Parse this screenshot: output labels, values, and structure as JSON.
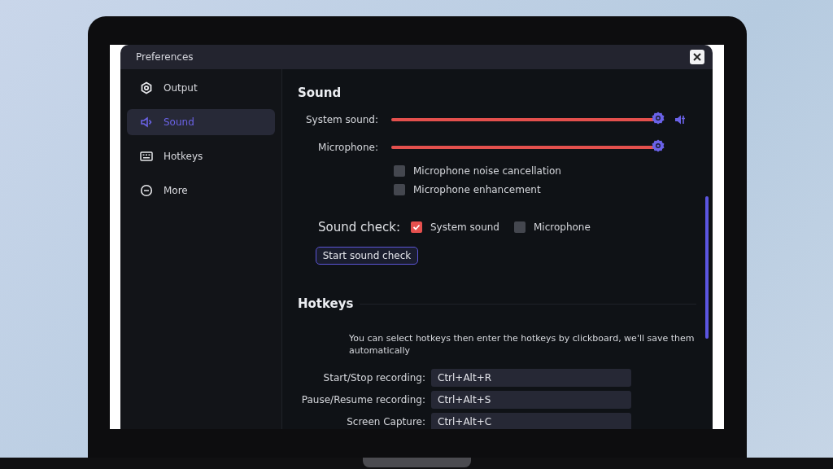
{
  "window": {
    "title": "Preferences"
  },
  "sidebar": {
    "items": [
      {
        "label": "Output",
        "selected": false
      },
      {
        "label": "Sound",
        "selected": true
      },
      {
        "label": "Hotkeys",
        "selected": false
      },
      {
        "label": "More",
        "selected": false
      }
    ]
  },
  "sound": {
    "title": "Sound",
    "sliders": [
      {
        "label": "System sound:",
        "level": 1,
        "volume_button": true
      },
      {
        "label": "Microphone:",
        "level": 1,
        "volume_button": false
      }
    ],
    "options": [
      {
        "label": "Microphone noise cancellation",
        "checked": false
      },
      {
        "label": "Microphone enhancement",
        "checked": false
      }
    ],
    "sound_check": {
      "label": "Sound check:",
      "options": [
        {
          "label": "System sound",
          "checked": true
        },
        {
          "label": "Microphone",
          "checked": false
        }
      ],
      "button": "Start sound check"
    }
  },
  "hotkeys": {
    "title": "Hotkeys",
    "note": "You can select hotkeys then enter the hotkeys by clickboard, we'll save them automatically",
    "rows": [
      {
        "label": "Start/Stop recording:",
        "value": "Ctrl+Alt+R"
      },
      {
        "label": "Pause/Resume recording:",
        "value": "Ctrl+Alt+S"
      },
      {
        "label": "Screen Capture:",
        "value": "Ctrl+Alt+C"
      }
    ]
  }
}
